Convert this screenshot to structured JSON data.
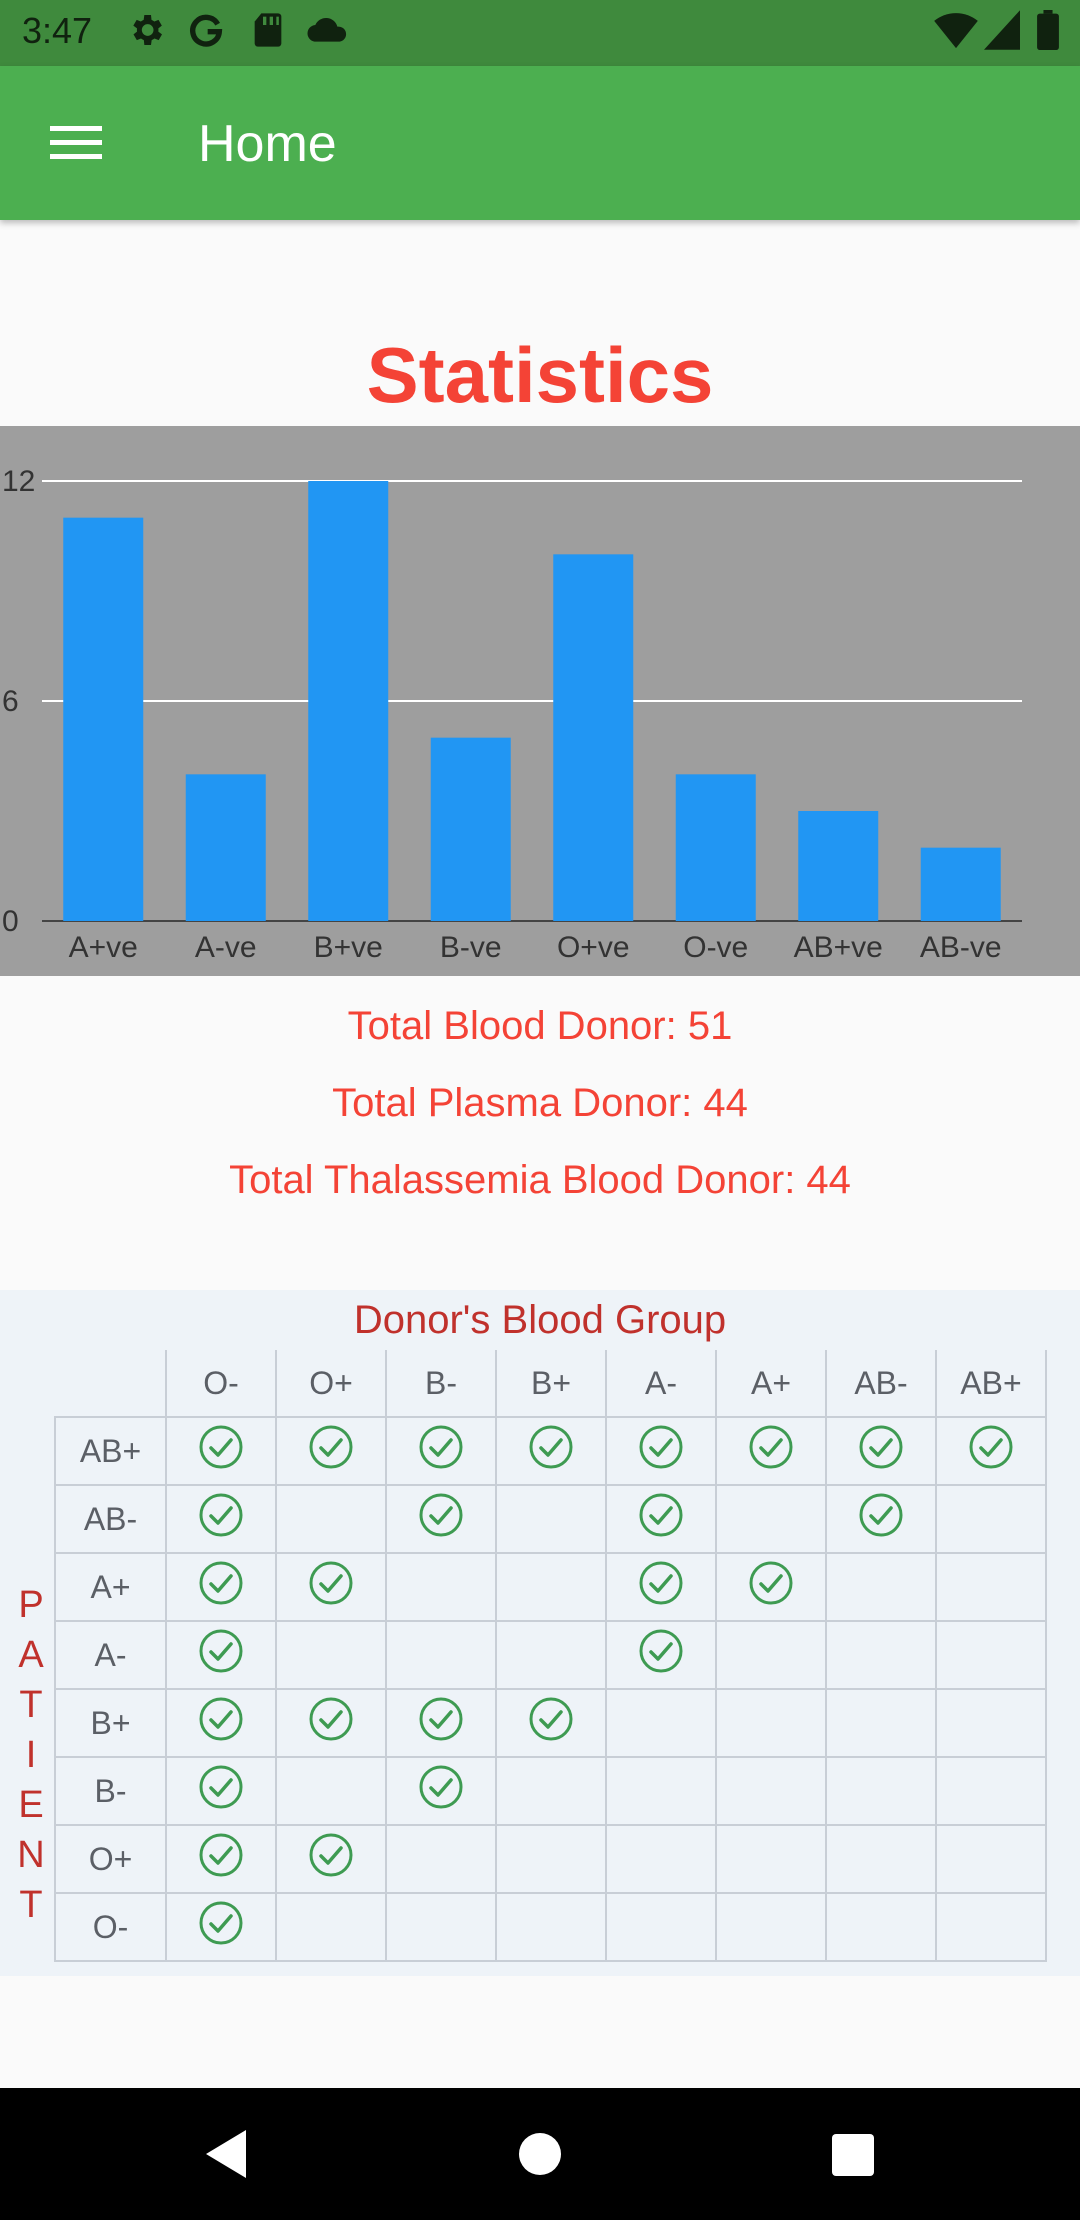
{
  "status_bar": {
    "time": "3:47",
    "left_icons": [
      "gear-icon",
      "google-icon",
      "sd-card-icon",
      "cloud-icon"
    ],
    "right_icons": [
      "wifi-icon",
      "signal-icon",
      "battery-icon"
    ]
  },
  "app_bar": {
    "title": "Home",
    "menu_icon": "menu-icon",
    "color": "#4CAF50"
  },
  "heading": "Statistics",
  "chart_data": {
    "type": "bar",
    "categories": [
      "A+ve",
      "A-ve",
      "B+ve",
      "B-ve",
      "O+ve",
      "O-ve",
      "AB+ve",
      "AB-ve"
    ],
    "values": [
      11,
      4,
      12,
      5,
      10,
      4,
      3,
      2
    ],
    "y_ticks": [
      "0",
      "6",
      "12"
    ],
    "ylim": [
      0,
      12
    ],
    "grid": true,
    "bar_color": "#2196F3",
    "background": "#9E9E9E"
  },
  "totals": {
    "blood": "Total Blood Donor: 51",
    "plasma": "Total Plasma Donor: 44",
    "thalassemia": "Total Thalassemia Blood Donor: 44"
  },
  "compatibility": {
    "title": "Donor's Blood Group",
    "side_label": "PATIENT",
    "donor_columns": [
      "O-",
      "O+",
      "B-",
      "B+",
      "A-",
      "A+",
      "AB-",
      "AB+"
    ],
    "rows": [
      {
        "patient": "AB+",
        "compatible": [
          true,
          true,
          true,
          true,
          true,
          true,
          true,
          true
        ]
      },
      {
        "patient": "AB-",
        "compatible": [
          true,
          false,
          true,
          false,
          true,
          false,
          true,
          false
        ]
      },
      {
        "patient": "A+",
        "compatible": [
          true,
          true,
          false,
          false,
          true,
          true,
          false,
          false
        ]
      },
      {
        "patient": "A-",
        "compatible": [
          true,
          false,
          false,
          false,
          true,
          false,
          false,
          false
        ]
      },
      {
        "patient": "B+",
        "compatible": [
          true,
          true,
          true,
          true,
          false,
          false,
          false,
          false
        ]
      },
      {
        "patient": "B-",
        "compatible": [
          true,
          false,
          true,
          false,
          false,
          false,
          false,
          false
        ]
      },
      {
        "patient": "O+",
        "compatible": [
          true,
          true,
          false,
          false,
          false,
          false,
          false,
          false
        ]
      },
      {
        "patient": "O-",
        "compatible": [
          true,
          false,
          false,
          false,
          false,
          false,
          false,
          false
        ]
      }
    ]
  },
  "nav_bar": {
    "buttons": [
      "back-icon",
      "home-icon",
      "recents-icon"
    ]
  }
}
